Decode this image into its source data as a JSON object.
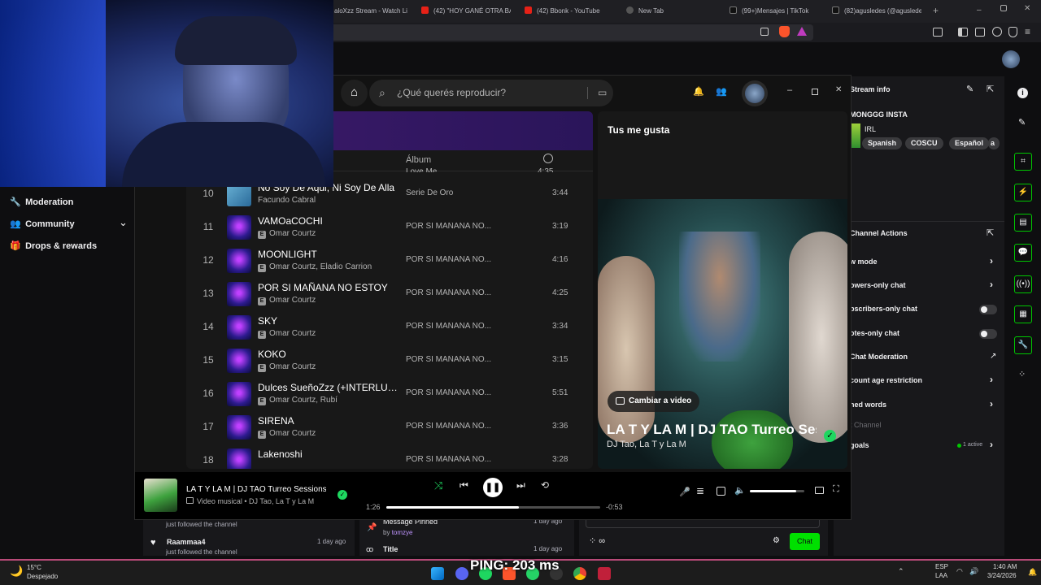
{
  "browser": {
    "tabs": [
      {
        "label": "aloXzz Stream - Watch Li"
      },
      {
        "label": "(42) \"HOY GANÉ OTRA BA"
      },
      {
        "label": "(42) Bbonk - YouTube"
      },
      {
        "label": "New Tab"
      },
      {
        "label": "(99+)Mensajes | TikTok"
      },
      {
        "label": "(82)agusledes (@agusledes"
      }
    ],
    "url": "m"
  },
  "twitch": {
    "nav": {
      "moderation": "Moderation",
      "community": "Community",
      "drops": "Drops & rewards"
    },
    "stream_info": {
      "title": "Stream info",
      "stream_title": "MONGGG INSTA",
      "category": "IRL",
      "tags": [
        "Spanish",
        "COSCU",
        "Español",
        "a"
      ]
    },
    "channel_actions": {
      "title": "Channel Actions",
      "items": [
        {
          "label": "w mode"
        },
        {
          "label": "owers-only chat"
        },
        {
          "label": "bscribers-only chat"
        },
        {
          "label": "otes-only chat"
        },
        {
          "label": "Chat Moderation"
        },
        {
          "label": "count age restriction"
        },
        {
          "label": "ned words"
        },
        {
          "label": "t Channel"
        },
        {
          "label": "goals"
        }
      ],
      "goals_status": "1 active"
    },
    "activity": [
      {
        "name": "",
        "note": "just followed the channel"
      },
      {
        "name": "Raammaa4",
        "time": "1 day ago",
        "note": "just followed the channel"
      }
    ],
    "pinned": {
      "label": "Message Pinned",
      "by": "by",
      "user": "tomzye",
      "time": "1 day ago",
      "title_label": "Title",
      "title_time": "1 day ago"
    },
    "chat_button": "Chat"
  },
  "spotify": {
    "search_placeholder": "¿Qué querés reproducir?",
    "columns": {
      "album": "Álbum"
    },
    "partial_row": {
      "title": "Love Me",
      "duration": "4:35"
    },
    "tracks": [
      {
        "num": "10",
        "title": "No Soy De Aqui, Ni Soy De Alla",
        "artist": "Facundo Cabral",
        "explicit": false,
        "album": "Serie De Oro",
        "duration": "3:44"
      },
      {
        "num": "11",
        "title": "VAMOaCOCHI",
        "artist": "Omar Courtz",
        "explicit": true,
        "album": "POR SI MAÑANA NO...",
        "duration": "3:19"
      },
      {
        "num": "12",
        "title": "MOONLIGHT",
        "artist": "Omar Courtz, Eladio Carrion",
        "explicit": true,
        "album": "POR SI MAÑANA NO...",
        "duration": "4:16"
      },
      {
        "num": "13",
        "title": "POR SI MAÑANA NO ESTOY",
        "artist": "Omar Courtz",
        "explicit": true,
        "album": "POR SI MAÑANA NO...",
        "duration": "4:25"
      },
      {
        "num": "14",
        "title": "SKY",
        "artist": "Omar Courtz",
        "explicit": true,
        "album": "POR SI MAÑANA NO...",
        "duration": "3:34"
      },
      {
        "num": "15",
        "title": "KOKO",
        "artist": "Omar Courtz",
        "explicit": true,
        "album": "POR SI MAÑANA NO...",
        "duration": "3:15"
      },
      {
        "num": "16",
        "title": "Dulces SueñoZzz (+INTERLUDE)",
        "artist": "Omar Courtz, Rubí",
        "explicit": true,
        "album": "POR SI MAÑANA NO...",
        "duration": "5:51"
      },
      {
        "num": "17",
        "title": "SIRENA",
        "artist": "Omar Courtz",
        "explicit": true,
        "album": "POR SI MAÑANA NO...",
        "duration": "3:36"
      },
      {
        "num": "18",
        "title": "Lakenoshi",
        "artist": "",
        "explicit": false,
        "album": "POR SI MAÑANA NO...",
        "duration": "3:28"
      }
    ],
    "right_panel": {
      "header": "Tus me gusta",
      "change_video": "Cambiar a video",
      "song_title": "LA T Y LA M | DJ TAO Turreo Sessions",
      "song_artist": "DJ Tao, La T y La M"
    },
    "now_playing": {
      "title": "LA T Y LA M | DJ TAO Turreo Sessions #",
      "type": "Video musical",
      "artist": "DJ Tao, La T y La M",
      "elapsed": "1:26",
      "remaining": "-0:53",
      "progress": 0.62,
      "volume": 0.85
    }
  },
  "taskbar": {
    "weather_temp": "15°C",
    "weather_desc": "Despejado",
    "overlay": "PING: 203 ms",
    "lang": "ESP",
    "lang2": "LAA",
    "time": "1:40 AM",
    "date": "3/24/2026"
  },
  "colors": {
    "spotify_green": "#1ed760",
    "twitch_green": "#00c800",
    "accent_purple": "#3d1a6b"
  }
}
